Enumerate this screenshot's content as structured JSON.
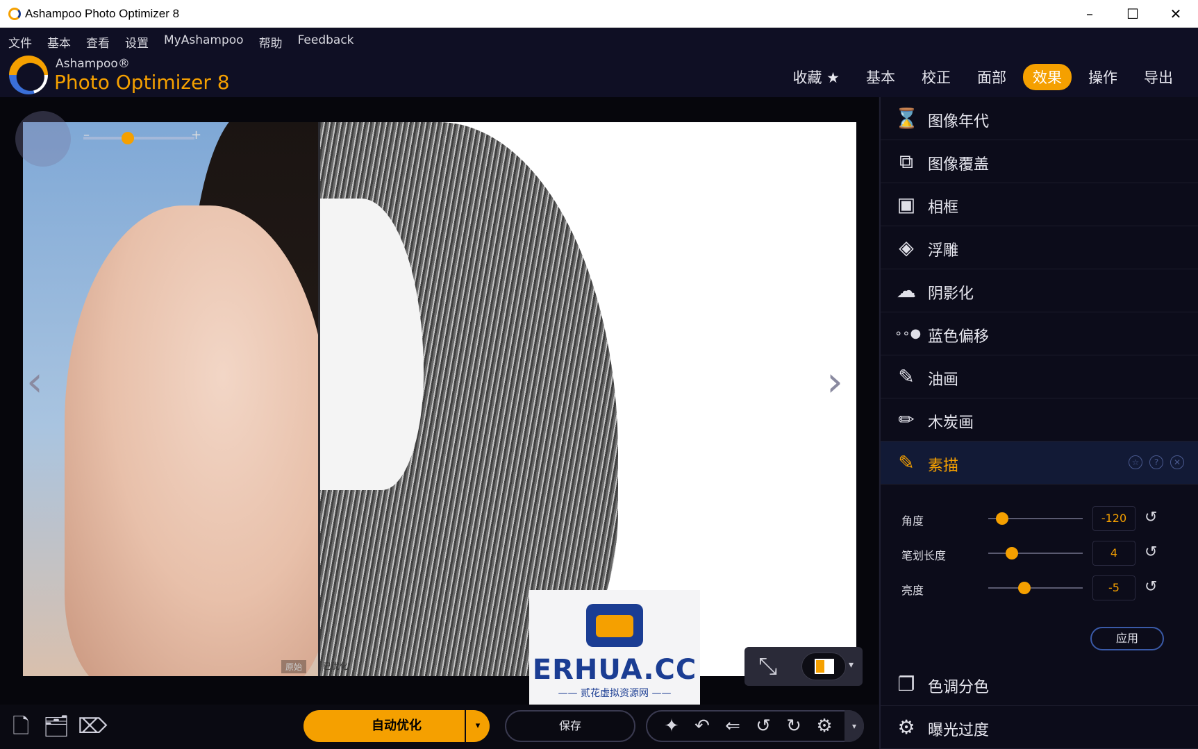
{
  "window": {
    "title": "Ashampoo Photo Optimizer 8",
    "minimize": "–",
    "maximize": "☐",
    "close": "✕"
  },
  "menu": [
    "文件",
    "基本",
    "查看",
    "设置",
    "MyAshampoo",
    "帮助",
    "Feedback"
  ],
  "brand": {
    "small": "Ashampoo®",
    "big": "Photo Optimizer 8"
  },
  "tabs": [
    {
      "label": "收藏 ★",
      "active": false
    },
    {
      "label": "基本",
      "active": false
    },
    {
      "label": "校正",
      "active": false
    },
    {
      "label": "面部",
      "active": false
    },
    {
      "label": "效果",
      "active": true
    },
    {
      "label": "操作",
      "active": false
    },
    {
      "label": "导出",
      "active": false
    }
  ],
  "canvas": {
    "label_original": "原始",
    "label_optimized": "已优化",
    "prev_arrow": "‹",
    "next_arrow": "›",
    "zoom_minus": "–",
    "zoom_plus": "+",
    "zoom_level": 0.4
  },
  "watermark": {
    "text": "ERHUA.CC",
    "subtext": "—— 贰花虚拟资源网 ——"
  },
  "effects": [
    {
      "label": "图像年代",
      "icon": "hourglass-icon",
      "glyph": "⌛",
      "active": false
    },
    {
      "label": "图像覆盖",
      "icon": "image-overlay-icon",
      "glyph": "⧉",
      "active": false
    },
    {
      "label": "相框",
      "icon": "frame-icon",
      "glyph": "▣",
      "active": false
    },
    {
      "label": "浮雕",
      "icon": "emboss-icon",
      "glyph": "◈",
      "active": false
    },
    {
      "label": "阴影化",
      "icon": "shadow-icon",
      "glyph": "☁",
      "active": false
    },
    {
      "label": "蓝色偏移",
      "icon": "blue-shift-icon",
      "glyph": "∘∘●",
      "active": false
    },
    {
      "label": "油画",
      "icon": "brush-icon",
      "glyph": "✎",
      "active": false
    },
    {
      "label": "木炭画",
      "icon": "charcoal-icon",
      "glyph": "✏",
      "active": false
    },
    {
      "label": "素描",
      "icon": "pencil-icon",
      "glyph": "✎",
      "active": true
    }
  ],
  "effects_after": [
    {
      "label": "色调分色",
      "icon": "posterize-icon",
      "glyph": "❐"
    },
    {
      "label": "曝光过度",
      "icon": "overexposure-icon",
      "glyph": "⚙"
    }
  ],
  "sketch_actions": {
    "favorite": "☆",
    "help": "?",
    "close": "✕"
  },
  "sliders": [
    {
      "label": "角度",
      "value": "-120",
      "position": 0.15
    },
    {
      "label": "笔划长度",
      "value": "4",
      "position": 0.25
    },
    {
      "label": "亮度",
      "value": "-5",
      "position": 0.38
    }
  ],
  "apply_label": "应用",
  "bottom": {
    "auto_optimize": "自动优化",
    "save": "保存",
    "tool_icons": [
      "magic-wand-icon",
      "undo-icon",
      "undo-all-icon",
      "rotate-left-icon",
      "rotate-right-icon",
      "settings-icon"
    ],
    "tool_glyphs": [
      "✦",
      "↶",
      "⇐",
      "↺",
      "↻",
      "⚙"
    ],
    "left_icons": [
      "add-file-icon",
      "add-folder-icon",
      "clean-icon"
    ],
    "left_glyphs": [
      "🗋",
      "🗂",
      "⌦"
    ]
  },
  "colors": {
    "accent": "#f5a000",
    "panel_bg": "#0c0c1a",
    "header_bg": "#0f0f24"
  }
}
